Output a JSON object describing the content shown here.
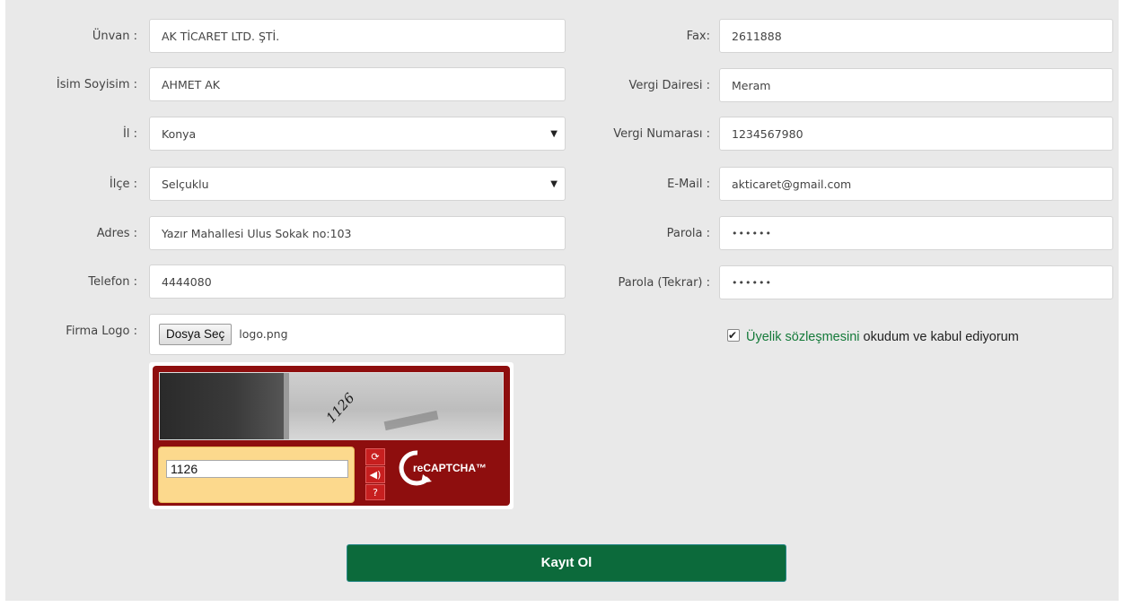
{
  "left_form": {
    "unvan": {
      "label": "Ünvan :",
      "value": "AK TİCARET LTD. ŞTİ."
    },
    "isim": {
      "label": "İsim Soyisim :",
      "value": "AHMET AK"
    },
    "il": {
      "label": "İl :",
      "value": "Konya"
    },
    "ilce": {
      "label": "İlçe :",
      "value": "Selçuklu"
    },
    "adres": {
      "label": "Adres :",
      "value": "Yazır Mahallesi Ulus Sokak no:103"
    },
    "telefon": {
      "label": "Telefon :",
      "value": "4444080"
    },
    "logo": {
      "label": "Firma Logo :",
      "button": "Dosya Seç",
      "file": "logo.png"
    }
  },
  "right_form": {
    "fax": {
      "label": "Fax:",
      "value": "2611888"
    },
    "vergi_dairesi": {
      "label": "Vergi Dairesi :",
      "value": "Meram"
    },
    "vergi_no": {
      "label": "Vergi Numarası :",
      "value": "1234567980"
    },
    "email": {
      "label": "E-Mail :",
      "value": "akticaret@gmail.com"
    },
    "parola": {
      "label": "Parola :",
      "value": "••••••"
    },
    "parola_tekrar": {
      "label": "Parola (Tekrar) :",
      "value": "••••••"
    }
  },
  "agreement": {
    "checked": true,
    "link_text": "Üyelik sözleşmesini",
    "text": " okudum ve kabul ediyorum"
  },
  "captcha": {
    "word": "1126",
    "input_value": "1126",
    "brand": "reCAPTCHA™"
  },
  "submit_label": "Kayıt Ol",
  "icons": {
    "select_arrow": "caret-down-icon",
    "captcha_refresh": "refresh-icon",
    "captcha_audio": "audio-icon",
    "captcha_help": "help-icon"
  },
  "colors": {
    "button": "#0c6a3b",
    "captcha_frame": "#8e0e0e",
    "captcha_input_area": "#fcd98d",
    "agreement_link": "#157a3a"
  }
}
